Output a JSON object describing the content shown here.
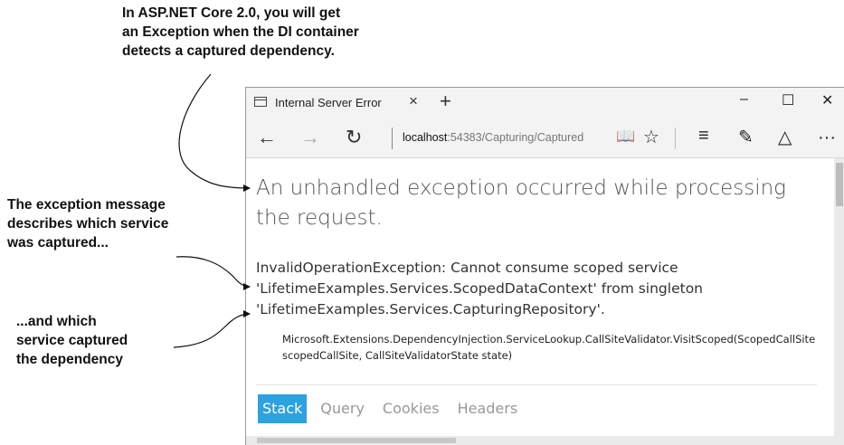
{
  "annotations": {
    "top": [
      "In ASP.NET Core 2.0, you will get",
      "an Exception when the DI container",
      "detects a captured dependency."
    ],
    "middle": [
      "The exception message",
      "describes which service",
      "was captured..."
    ],
    "bottom": [
      "...and which",
      "service captured",
      "the dependency"
    ]
  },
  "browser": {
    "tab_title": "Internal Server Error",
    "tab_close": "×",
    "new_tab": "+",
    "window": {
      "minimize": "–",
      "maximize": "☐",
      "close": "✕"
    },
    "nav": {
      "back": "←",
      "forward": "→",
      "refresh": "↻"
    },
    "address": {
      "host": "localhost",
      "rest": ":54383/Capturing/Captured"
    },
    "toolbar_icons": {
      "reading_view": "📖",
      "favorite": "☆",
      "hub": "≡",
      "notes": "✎",
      "share": "△",
      "more": "···"
    }
  },
  "page": {
    "heading": "An unhandled exception occurred while processing the request.",
    "message": [
      "InvalidOperationException: Cannot consume scoped service",
      "'LifetimeExamples.Services.ScopedDataContext' from singleton",
      "'LifetimeExamples.Services.CapturingRepository'."
    ],
    "stack_trace": [
      "Microsoft.Extensions.DependencyInjection.ServiceLookup.CallSiteValidator.VisitScoped(ScopedCallSite",
      "scopedCallSite, CallSiteValidatorState state)"
    ],
    "tabs": [
      "Stack",
      "Query",
      "Cookies",
      "Headers"
    ],
    "active_tab": "Stack"
  },
  "colors": {
    "accent": "#2ea1e0",
    "chrome": "#f3f3f3"
  }
}
